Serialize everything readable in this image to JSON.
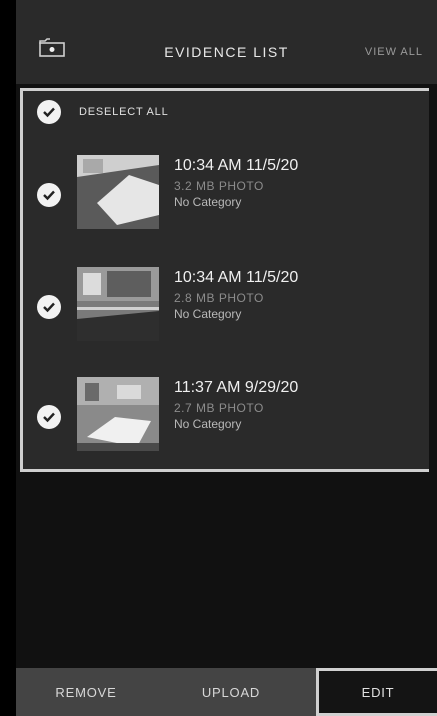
{
  "header": {
    "back_icon": "camera-back-icon",
    "title": "EVIDENCE LIST",
    "view_all": "VIEW ALL"
  },
  "selection": {
    "deselect_all": "DESELECT ALL"
  },
  "items": [
    {
      "title": "10:34 AM 11/5/20",
      "meta": "3.2 MB PHOTO",
      "category": "No Category",
      "selected": true
    },
    {
      "title": "10:34 AM 11/5/20",
      "meta": "2.8 MB PHOTO",
      "category": "No Category",
      "selected": true
    },
    {
      "title": "11:37 AM 9/29/20",
      "meta": "2.7 MB PHOTO",
      "category": "No Category",
      "selected": true
    }
  ],
  "footer": {
    "remove": "REMOVE",
    "upload": "UPLOAD",
    "edit": "EDIT"
  },
  "colors": {
    "background": "#111111",
    "panel": "#2a2a2a",
    "accent_border": "#cfcfcf"
  }
}
